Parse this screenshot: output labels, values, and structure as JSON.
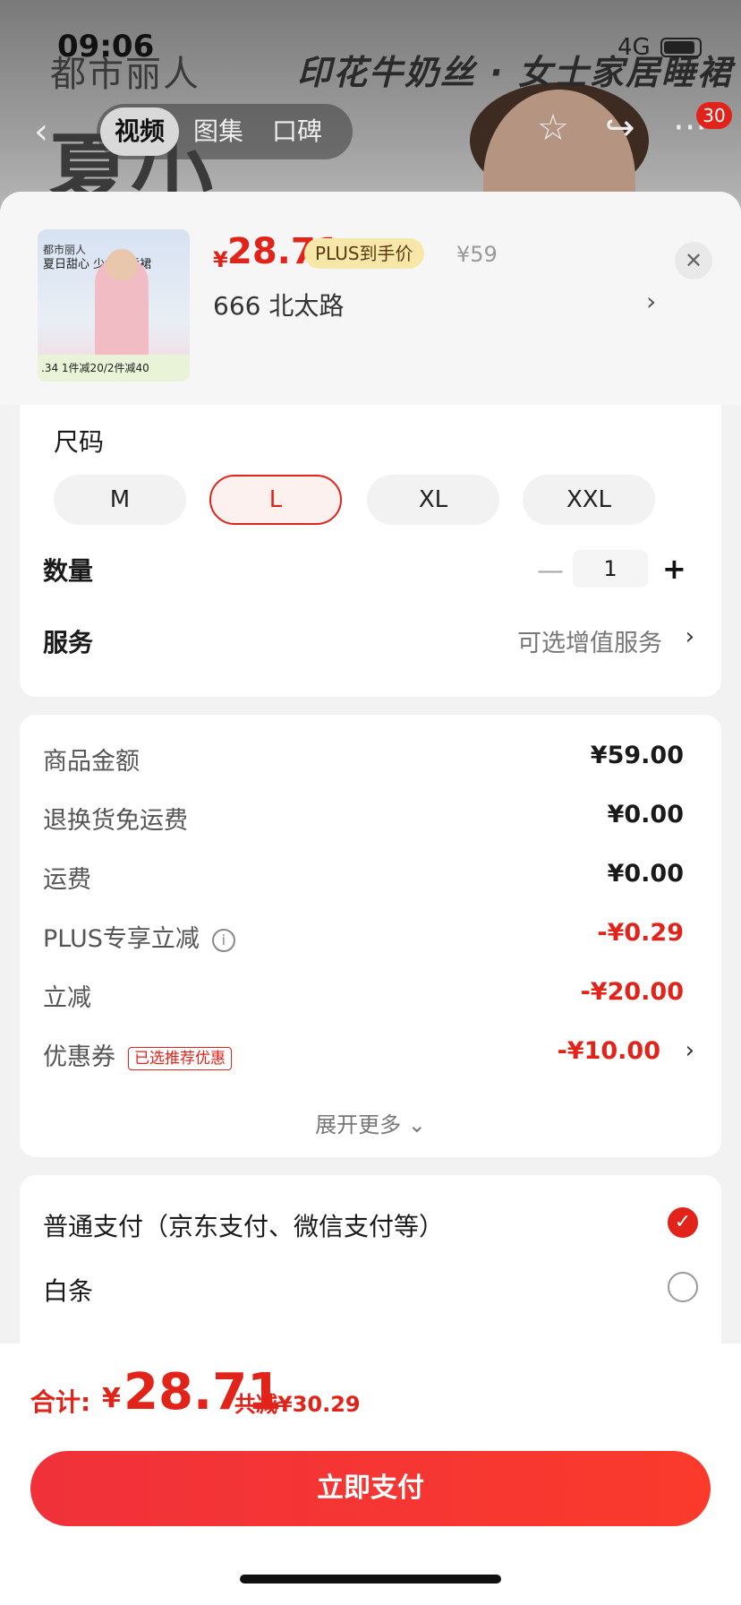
{
  "status_bar": {
    "time": "09:06",
    "network": "4G"
  },
  "background": {
    "brand": "都市丽人",
    "banner": "印花牛奶丝 · 女士家居睡裙",
    "big_text": "夏小",
    "tabs": [
      {
        "label": "视频",
        "active": true
      },
      {
        "label": "图集",
        "active": false
      },
      {
        "label": "口碑",
        "active": false
      }
    ],
    "cart_badge": "30"
  },
  "product": {
    "thumb": {
      "brand": "都市丽人",
      "slogan": "夏日甜心 少女风睡裙",
      "promo": "1件减20/2件减40",
      "price_tail": ".34"
    },
    "price_symbol": "¥",
    "price": "28.71",
    "plus_tag": "PLUS到手价",
    "original_price": "¥59",
    "address": "666  北太路"
  },
  "options": {
    "size_title": "尺码",
    "sizes": [
      {
        "label": "M",
        "selected": false
      },
      {
        "label": "L",
        "selected": true
      },
      {
        "label": "XL",
        "selected": false
      },
      {
        "label": "XXL",
        "selected": false
      }
    ],
    "quantity_label": "数量",
    "quantity": "1",
    "service_label": "服务",
    "service_value": "可选增值服务"
  },
  "fees": {
    "rows": [
      {
        "label": "商品金额",
        "value": "¥59.00",
        "red": false
      },
      {
        "label": "退换货免运费",
        "value": "¥0.00",
        "red": false
      },
      {
        "label": "运费",
        "value": "¥0.00",
        "red": false
      },
      {
        "label": "PLUS专享立减",
        "value": "-¥0.29",
        "red": true
      },
      {
        "label": "立减",
        "value": "-¥20.00",
        "red": true
      },
      {
        "label": "优惠券",
        "value": "-¥10.00",
        "red": true
      }
    ],
    "coupon_tag": "已选推荐优惠",
    "expand": "展开更多"
  },
  "payment": {
    "options": [
      {
        "label": "普通支付（京东支付、微信支付等）",
        "selected": true
      },
      {
        "label": "白条",
        "selected": false
      }
    ]
  },
  "footer": {
    "total_label": "合计:",
    "currency": "¥",
    "total": "28.71",
    "saved": "共减¥30.29",
    "pay_button": "立即支付"
  },
  "colors": {
    "accent": "#e2231a",
    "plus_tag_bg": "#f7e7a8"
  }
}
